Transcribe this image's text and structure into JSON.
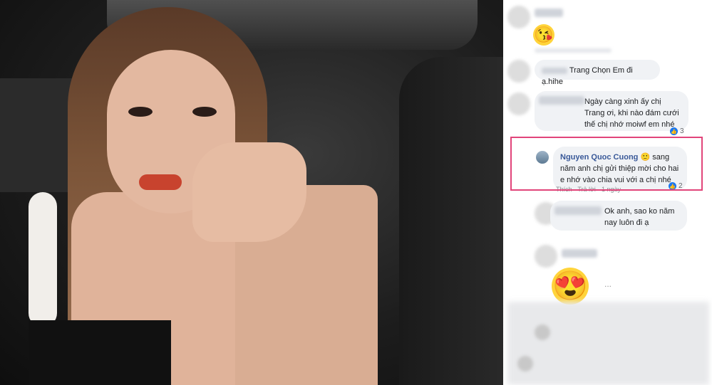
{
  "comments": [
    {
      "text": "",
      "reaction_icon": "kiss-emoji"
    },
    {
      "text": "Trang Chọn Em đi ạ.hihe"
    },
    {
      "text": "Ngày càng xinh ấy chị Trang ơi, khi nào đám cưới thế chị nhớ moiwf em nhé",
      "likes": "3"
    },
    {
      "author": "Nguyen Quoc Cuong",
      "text": "sang năm anh chị gửi thiệp mời cho hai e nhớ vào chia vui với a chị nhé",
      "likes": "2",
      "actions": {
        "like": "Thích",
        "reply": "Trả lời",
        "time": "1 ngày"
      }
    },
    {
      "text": "Ok anh, sao ko năm nay luôn đi ạ"
    },
    {
      "reaction_icon": "heart-eyes-emoji",
      "more": "..."
    }
  ],
  "colors": {
    "highlight_border": "#e1457a",
    "author_name": "#385898",
    "like_blue": "#1877f2"
  }
}
